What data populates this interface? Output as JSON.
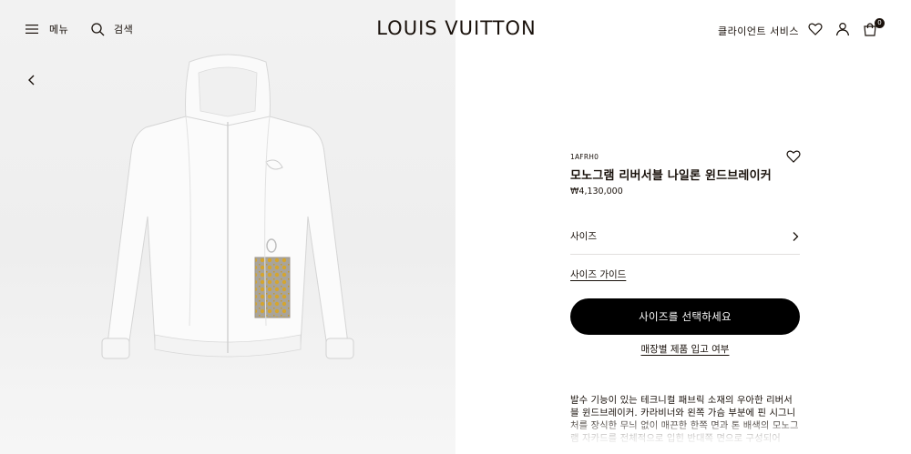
{
  "header": {
    "menu_label": "메뉴",
    "search_label": "검색",
    "logo_text": "LOUIS VUITTON",
    "client_services_label": "클라이언트 서비스",
    "cart_count": "0"
  },
  "product": {
    "reference": "1AFRH0",
    "title": "모노그램 리버서블 나일론 윈드브레이커",
    "price": "₩4,130,000",
    "size_label": "사이즈",
    "size_guide_label": "사이즈 가이드",
    "select_size_button": "사이즈를 선택하세요",
    "store_stock_link": "매장별 제품 입고 여부",
    "description": "발수 기능이 있는 테크니컬 패브릭 소재의 우아한 리버서블 윈드브레이커. 카라비너와 왼쪽 가슴 부분에 핀 시그니처를 장식한 무늬 없이 매끈한 한쪽 면과 톤 배색의 모노그램 자카드를 전체적으로 입힌 반대쪽 면으로 구성되어"
  },
  "colors": {
    "text": "#19110b",
    "button_bg": "#000000",
    "image_bg": "#efefef"
  }
}
